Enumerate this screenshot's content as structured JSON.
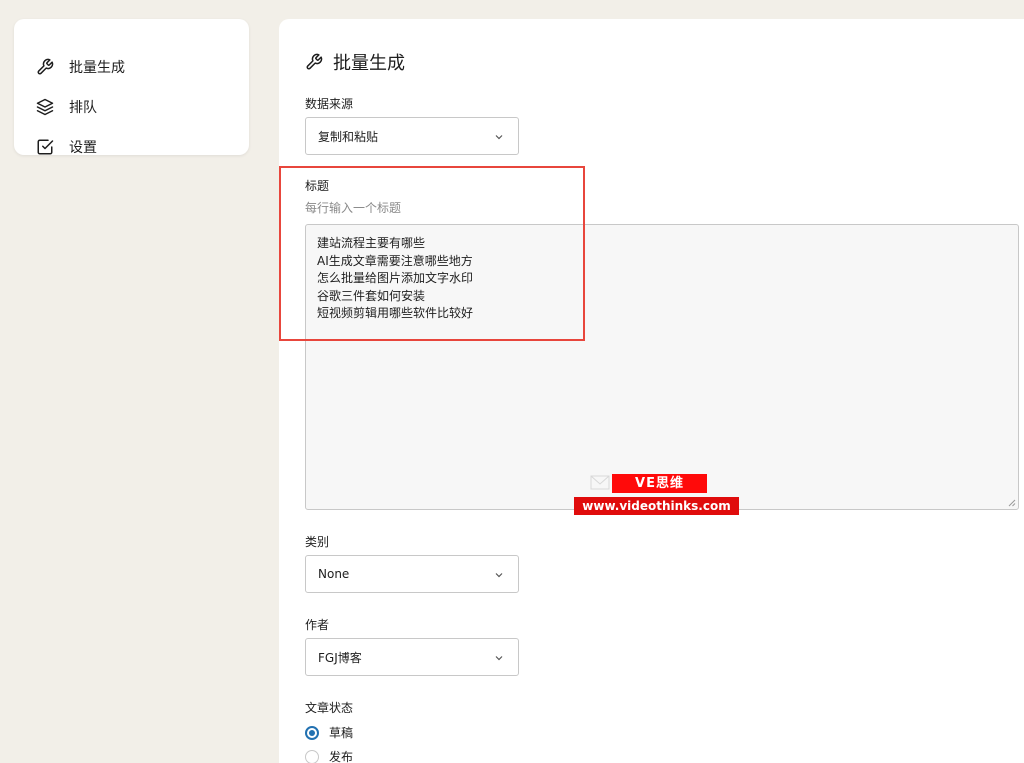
{
  "sidebar": {
    "items": [
      {
        "label": "批量生成",
        "icon": "wrench-icon"
      },
      {
        "label": "排队",
        "icon": "layers-icon"
      },
      {
        "label": "设置",
        "icon": "checkbox-icon"
      }
    ]
  },
  "main": {
    "title": "批量生成",
    "title_icon": "wrench-icon",
    "data_source": {
      "label": "数据来源",
      "selected": "复制和粘贴"
    },
    "titles": {
      "label": "标题",
      "help": "每行输入一个标题",
      "lines": [
        "建站流程主要有哪些",
        "AI生成文章需要注意哪些地方",
        "怎么批量给图片添加文字水印",
        "谷歌三件套如何安装",
        "短视频剪辑用哪些软件比较好"
      ]
    },
    "category": {
      "label": "类别",
      "selected": "None"
    },
    "author": {
      "label": "作者",
      "selected": "FGJ博客"
    },
    "post_status": {
      "label": "文章状态",
      "options": [
        {
          "label": "草稿",
          "checked": true
        },
        {
          "label": "发布",
          "checked": false
        }
      ]
    }
  },
  "watermark": {
    "brand": "VE思维",
    "url": "www.videothinks.com"
  },
  "colors": {
    "accent": "#2271b1",
    "highlight": "#e8463c",
    "watermark_red": "#ff0a0a",
    "background": "#f2efe8"
  }
}
